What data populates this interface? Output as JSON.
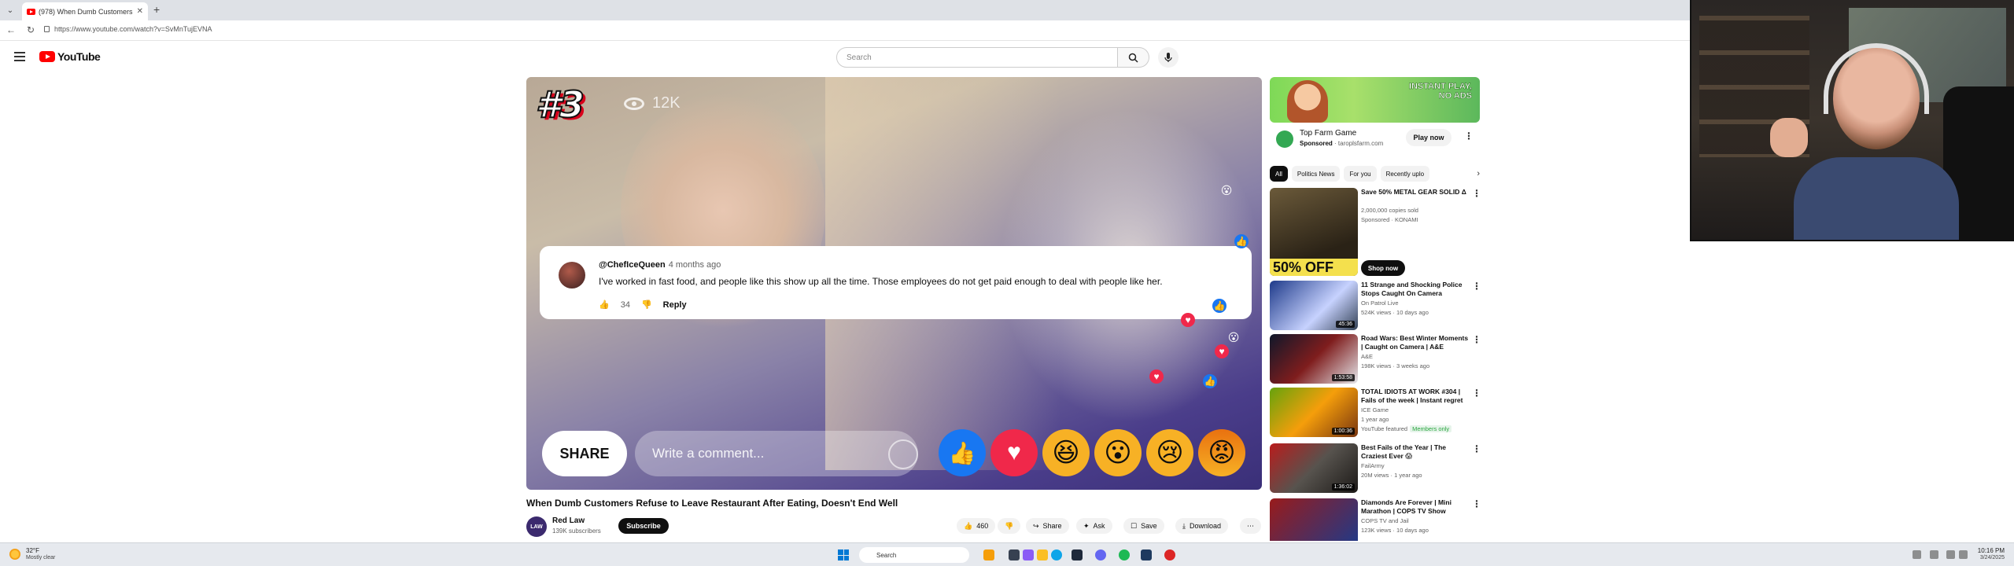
{
  "browser": {
    "tab_title": "(978) When Dumb Customers",
    "url": "https://www.youtube.com/watch?v=SvMnTujEVNA"
  },
  "header": {
    "logo_text": "YouTube",
    "search_placeholder": "Search"
  },
  "player": {
    "rank_badge": "#3",
    "views": "12K",
    "comment": {
      "author": "@ChefIceQueen",
      "time": "4 months ago",
      "text": "I've worked in fast food, and people like this show up all the time. Those employees do not get paid enough to deal with people like her.",
      "likes": "34",
      "reply_label": "Reply"
    },
    "share_label": "SHARE",
    "write_placeholder": "Write a comment..."
  },
  "video": {
    "title": "When Dumb Customers Refuse to Leave Restaurant After Eating, Doesn't End Well",
    "channel": "Red Law",
    "subscribers": "139K subscribers",
    "channel_avatar_text": "LAW",
    "subscribe_label": "Subscribe",
    "likes": "460",
    "share_label": "Share",
    "ask_label": "Ask",
    "save_label": "Save",
    "download_label": "Download"
  },
  "sidebar": {
    "ad": {
      "banner_text": "INSTANT PLAY, NO ADS",
      "name": "Top Farm Game",
      "sponsored": "Sponsored",
      "domain": "· taroplsfarm.com",
      "play_label": "Play now"
    },
    "chips": [
      "All",
      "Politics News",
      "For you",
      "Recently uplo"
    ],
    "recommendations": [
      {
        "title": "Save 50% METAL GEAR SOLID Δ",
        "channel": "2,000,000 copies sold",
        "meta": "Sponsored · KONAMI",
        "extra": "",
        "duration": "",
        "shop_label": "Shop now",
        "off_text": "50% OFF"
      },
      {
        "title": "11 Strange and Shocking Police Stops Caught On Camera",
        "channel": "On Patrol Live",
        "meta": "524K views · 10 days ago",
        "extra": "",
        "duration": "45:36"
      },
      {
        "title": "Road Wars: Best Winter Moments | Caught on Camera | A&E",
        "channel": "A&E",
        "meta": "198K views · 3 weeks ago",
        "extra": "",
        "duration": "1:53:58"
      },
      {
        "title": "TOTAL IDIOTS AT WORK #304 | Fails of the week | Instant regret",
        "channel": "ICE Game",
        "meta": "1 year ago",
        "extra": "YouTube featured",
        "members": "Members only",
        "duration": "1:00:36"
      },
      {
        "title": "Best Fails of the Year | The Craziest Ever 😱",
        "channel": "FailArmy",
        "meta": "20M views · 1 year ago",
        "extra": "",
        "duration": "1:36:02"
      },
      {
        "title": "Diamonds Are Forever | Mini Marathon | COPS TV Show",
        "channel": "COPS TV and Jail",
        "meta": "123K views · 10 days ago",
        "extra": "",
        "duration": ""
      }
    ]
  },
  "taskbar": {
    "temp": "32°F",
    "weather": "Mostly clear",
    "search_placeholder": "Search",
    "time": "10:16 PM",
    "date": "3/24/2025"
  },
  "colors": {
    "youtube_red": "#ff0000",
    "like_blue": "#1877f2",
    "love_red": "#f0284a"
  }
}
